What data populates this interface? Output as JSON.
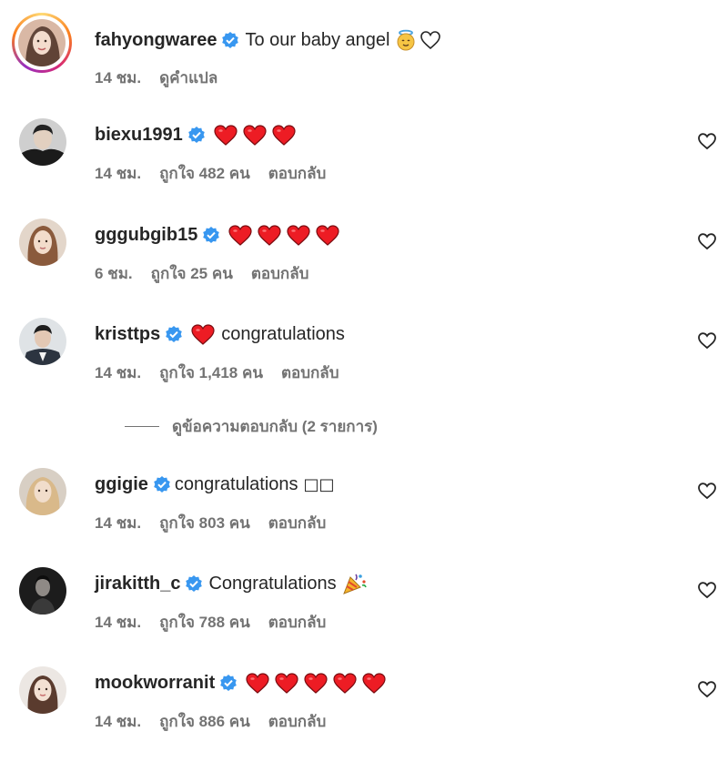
{
  "comments": [
    {
      "username": "fahyongwaree",
      "verified": true,
      "text": "To our baby angel",
      "emoji_icons": [
        "angel-emoji-icon",
        "white-heart-icon"
      ],
      "time": "14 ชม.",
      "translate": "ดูคำแปล"
    },
    {
      "username": "biexu1991",
      "verified": true,
      "text": "",
      "hearts": 3,
      "time": "14 ชม.",
      "likes": "ถูกใจ 482 คน",
      "reply": "ตอบกลับ"
    },
    {
      "username": "gggubgib15",
      "verified": true,
      "text": "",
      "hearts": 4,
      "time": "6 ชม.",
      "likes": "ถูกใจ 25 คน",
      "reply": "ตอบกลับ"
    },
    {
      "username": "kristtps",
      "verified": true,
      "text": "congratulations",
      "hearts": 1,
      "time": "14 ชม.",
      "likes": "ถูกใจ 1,418 คน",
      "reply": "ตอบกลับ"
    },
    {
      "username": "ggigie",
      "verified": true,
      "text": "congratulations",
      "trailing_glyphs": "□□",
      "time": "14 ชม.",
      "likes": "ถูกใจ 803 คน",
      "reply": "ตอบกลับ"
    },
    {
      "username": "jirakitth_c",
      "verified": true,
      "text": "Congratulations",
      "emoji_icons": [
        "party-popper-icon"
      ],
      "time": "14 ชม.",
      "likes": "ถูกใจ 788 คน",
      "reply": "ตอบกลับ"
    },
    {
      "username": "mookworranit",
      "verified": true,
      "text": "",
      "hearts": 5,
      "time": "14 ชม.",
      "likes": "ถูกใจ 886 คน",
      "reply": "ตอบกลับ"
    }
  ],
  "view_replies": "ดูข้อความตอบกลับ (2 รายการ)",
  "colors": {
    "verified_blue": "#3897f0",
    "heart_red": "#ed1c24",
    "meta_gray": "#737373"
  }
}
